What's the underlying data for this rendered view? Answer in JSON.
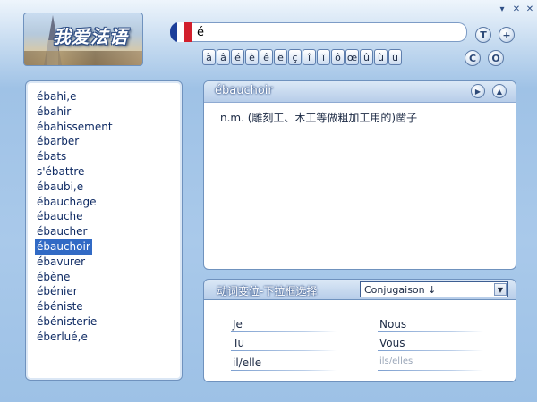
{
  "window": {
    "controls": [
      "▾",
      "✕",
      "✕"
    ]
  },
  "logo": {
    "text": "我爱法语"
  },
  "search": {
    "value": "é",
    "flag_colors": [
      "#1d3f9a",
      "#ffffff",
      "#d21f2c"
    ]
  },
  "toolbar": {
    "t_label": "T",
    "plus_label": "+",
    "back_label": "C",
    "forward_label": "O"
  },
  "accent_keys": [
    "à",
    "â",
    "é",
    "è",
    "ê",
    "ë",
    "ç",
    "î",
    "ï",
    "ô",
    "œ",
    "û",
    "ù",
    "ü"
  ],
  "word_list": {
    "items": [
      "ébahi,e",
      "ébahir",
      "ébahissement",
      "ébarber",
      "ébats",
      "s'ébattre",
      "ébaubi,e",
      "ébauchage",
      "ébauche",
      "ébaucher",
      "ébauchoir",
      "ébavurer",
      "ébène",
      "ébénier",
      "ébéniste",
      "ébénisterie",
      "éberlué,e"
    ],
    "selected_index": 10
  },
  "definition": {
    "title": "ébauchoir",
    "text": "n.m. (雕刻工、木工等做粗加工用的)凿子"
  },
  "conjugation": {
    "title": "动词变位-下拉框选择",
    "select_value": "Conjugaison ↓",
    "pronouns": [
      "Je",
      "Nous",
      "Tu",
      "Vous",
      "il/elle",
      "ils/elles"
    ]
  },
  "colors": {
    "accent": "#316ac5",
    "panel_border": "#6f92be"
  }
}
